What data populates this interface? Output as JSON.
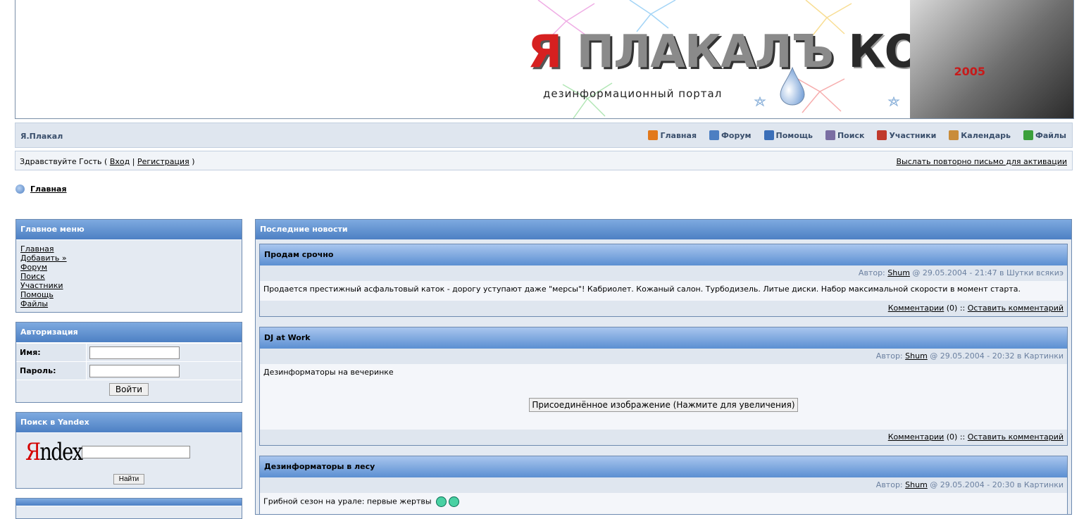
{
  "header": {
    "logo_ya": "Я",
    "logo_main": "ПЛАКАЛЪ",
    "logo_com": "КОМ",
    "tagline": "дезинформационный портал",
    "year": "2005"
  },
  "navbar": {
    "site_name": "Я.Плакал",
    "items": [
      {
        "label": "Главная",
        "icon": "home-icon",
        "color": "#e2791c"
      },
      {
        "label": "Форум",
        "icon": "forum-icon",
        "color": "#4d7fc2"
      },
      {
        "label": "Помощь",
        "icon": "help-icon",
        "color": "#3b6fb8"
      },
      {
        "label": "Поиск",
        "icon": "search-icon",
        "color": "#7a6ea3"
      },
      {
        "label": "Участники",
        "icon": "members-icon",
        "color": "#c0392b"
      },
      {
        "label": "Календарь",
        "icon": "calendar-icon",
        "color": "#c98c3a"
      },
      {
        "label": "Файлы",
        "icon": "files-icon",
        "color": "#3ca03c"
      }
    ]
  },
  "userbar": {
    "greet_prefix": "Здравствуйте Гость (",
    "login": "Вход",
    "sep": "|",
    "register": "Регистрация",
    "greet_suffix": ")",
    "resend": "Выслать повторно письмо для активации"
  },
  "breadcrumb": "Главная",
  "main_menu": {
    "title": "Главное меню",
    "items": [
      "Главная",
      "Добавить »",
      "Форум",
      "Поиск",
      "Участники",
      "Помощь",
      "Файлы"
    ]
  },
  "auth": {
    "title": "Авторизация",
    "name_label": "Имя:",
    "password_label": "Пароль:",
    "submit": "Войти"
  },
  "yandex": {
    "title": "Поиск в Yandex",
    "logo_y": "Я",
    "logo_rest": "ndex",
    "button": "Найти"
  },
  "news": {
    "title": "Последние новости",
    "items": [
      {
        "title": "Продам срочно",
        "author_prefix": "Автор:",
        "author": "Shum",
        "meta_suffix": "@ 29.05.2004 - 21:47 в Шутки всякиэ",
        "body": "Продается престижный асфальтовый каток - дорогу уступают даже \"мерсы\"! Кабриолет. Кожаный салон. Турбодизель. Литые диски. Набор максимальной скорости в момент старта.",
        "comments_link": "Комментарии",
        "comments_count": "(0) ::",
        "add_comment": "Оставить комментарий"
      },
      {
        "title": "DJ at Work",
        "author_prefix": "Автор:",
        "author": "Shum",
        "meta_suffix": "@ 29.05.2004 - 20:32 в Картинки",
        "body": "Дезинформаторы на вечеринке",
        "image_label": "Присоединённое изображение (Нажмите для увеличения)",
        "comments_link": "Комментарии",
        "comments_count": "(0) ::",
        "add_comment": "Оставить комментарий"
      },
      {
        "title": "Дезинформаторы в лесу",
        "author_prefix": "Автор:",
        "author": "Shum",
        "meta_suffix": "@ 29.05.2004 - 20:30 в Картинки",
        "body": "Грибной сезон на урале: первые жертвы"
      }
    ]
  }
}
